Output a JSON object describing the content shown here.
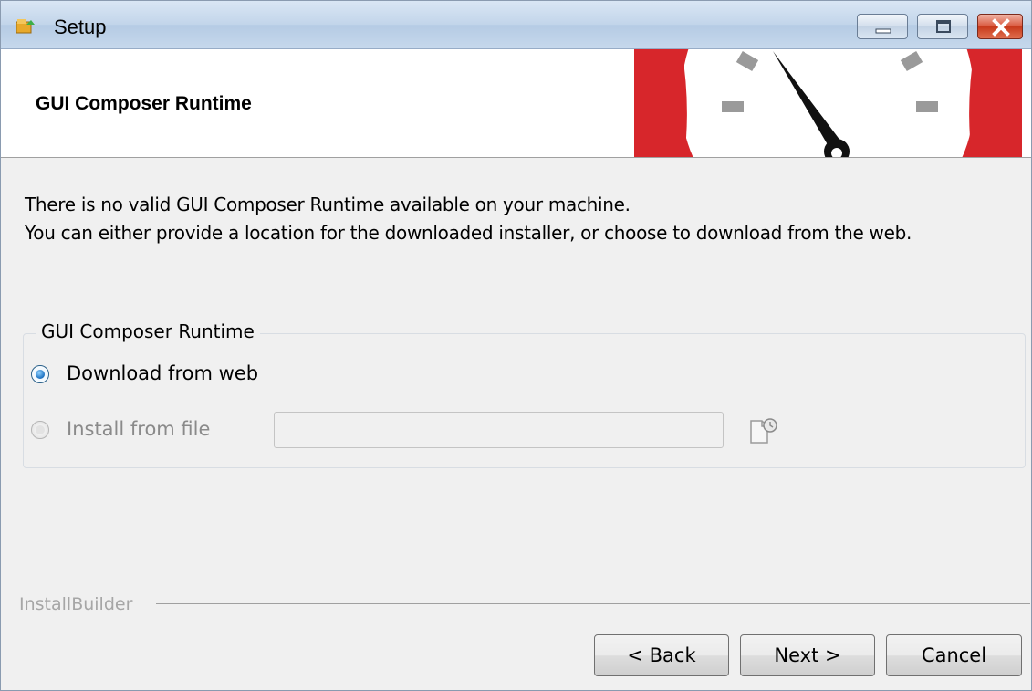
{
  "window": {
    "title": "Setup",
    "icon": "setup-app-icon",
    "controls": [
      "minimize-icon",
      "maximize-icon",
      "close-icon"
    ]
  },
  "header": {
    "title": "GUI Composer Runtime",
    "banner_icon": "gauge-speedometer-icon",
    "banner_color": "#d7262b"
  },
  "intro": {
    "line1": "There is no valid GUI Composer Runtime available on your machine.",
    "line2": "You can either provide a location for the downloaded installer, or choose to download from the web."
  },
  "group": {
    "label": "GUI Composer Runtime",
    "options": [
      {
        "label": "Download from web",
        "selected": true,
        "enabled": true
      },
      {
        "label": "Install from file",
        "selected": false,
        "enabled": false
      }
    ],
    "file_value": "",
    "browse_icon": "browse-file-icon"
  },
  "footer": {
    "brand": "InstallBuilder",
    "back_label": "< Back",
    "next_label": "Next >",
    "cancel_label": "Cancel"
  }
}
